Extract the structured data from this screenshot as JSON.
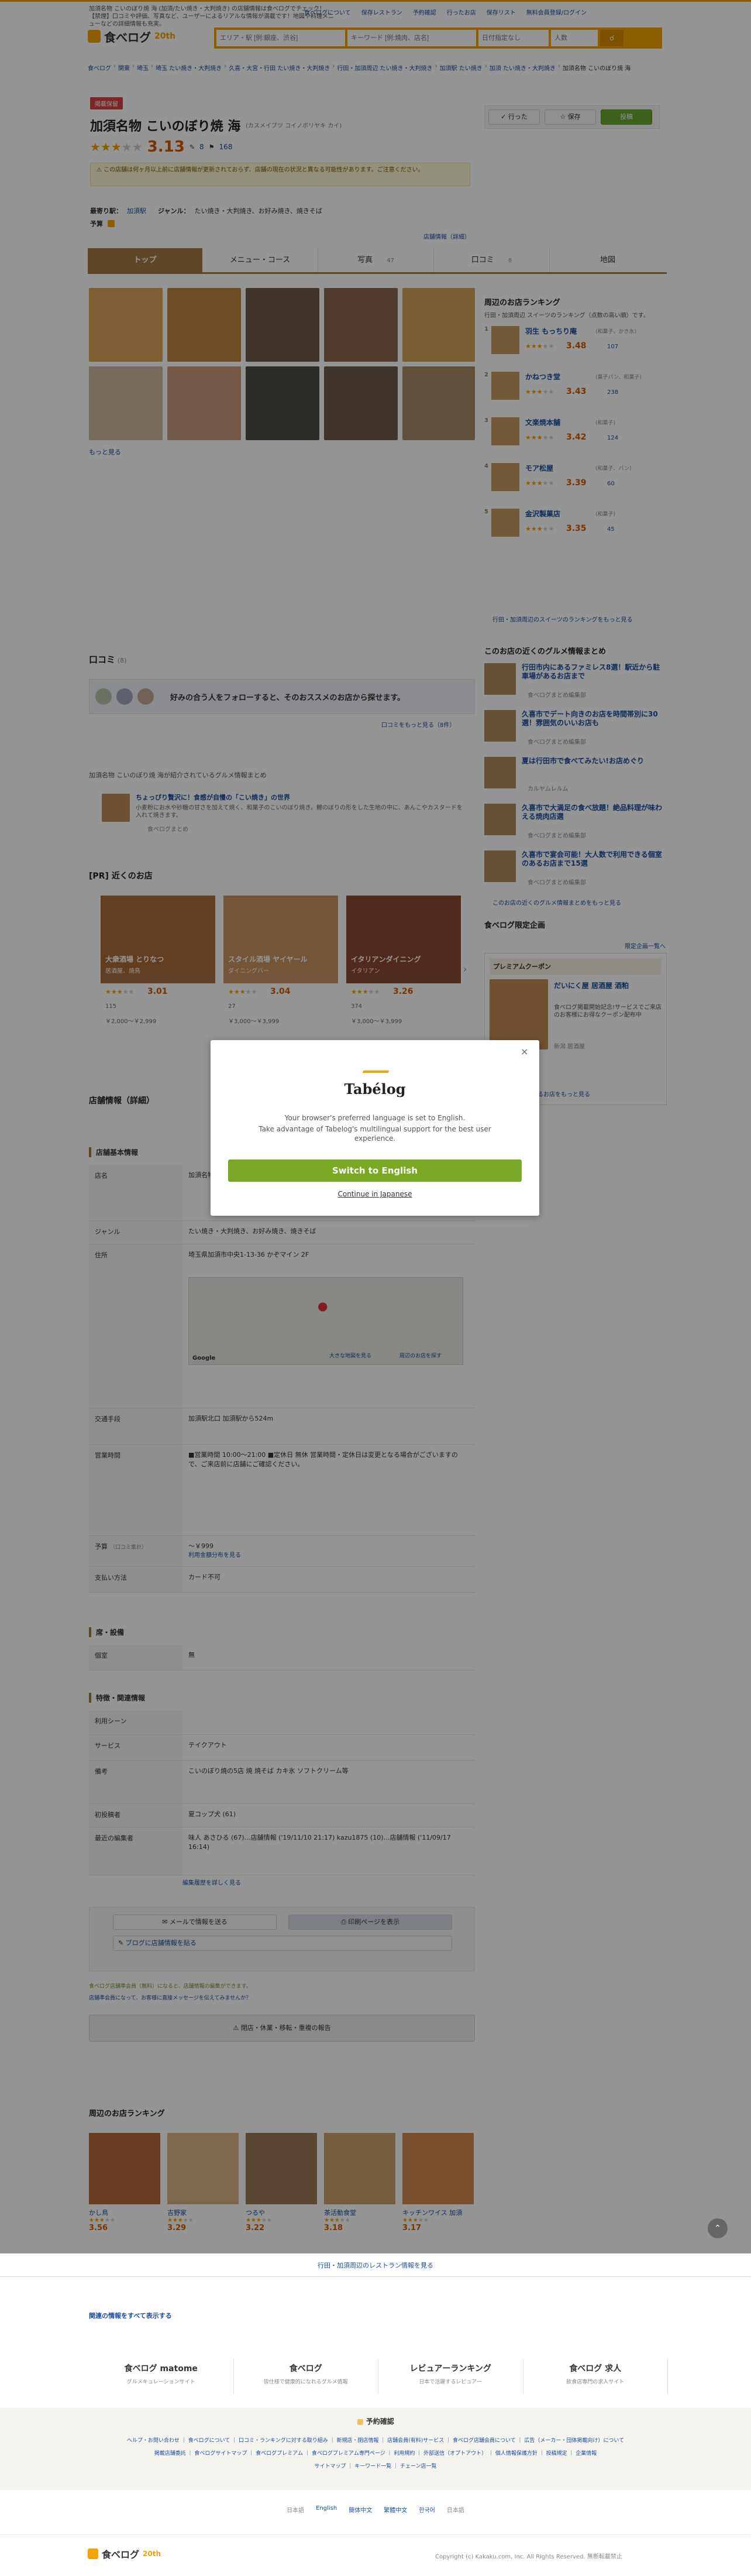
{
  "header": {
    "top_desc": "加須名物 こいのぼり焼 海 (加須/たい焼き・大判焼き) の店舗情報は食べログでチェック！ 【禁煙】口コミや評価、写真など、ユーザーによるリアルな情報が満載です！地図や料理メニューなどの詳細情報も充実。",
    "links": [
      "食べログについて",
      "保存レストラン",
      "予約確認",
      "行ったお店",
      "保存リスト",
      "無料会員登録/ログイン"
    ],
    "logo": "食べログ",
    "logo_badge": "20th",
    "search_area_placeholder": "エリア・駅 [例:銀座、渋谷]",
    "search_keyword_placeholder": "キーワード [例:焼肉、店名]",
    "date_placeholder": "日付指定なし",
    "people_placeholder": "人数"
  },
  "breadcrumb": [
    "食べログ",
    "関東",
    "埼玉",
    "埼玉 たい焼き・大判焼き",
    "久喜・大宮・行田 たい焼き・大判焼き",
    "行田・加須周辺 たい焼き・大判焼き",
    "加須駅 たい焼き",
    "加須 たい焼き・大判焼き",
    "加須名物 こいのぼり焼 海"
  ],
  "shop": {
    "badge": "掲載保留",
    "name": "加須名物 こいのぼり焼 海",
    "kana": "(カスメイブツ コイノボリヤキ カイ)",
    "rating": "3.13",
    "reviews": "8",
    "saves": "168",
    "notice": "この店舗は何ヶ月以上前に店舗情報が更新されておらず、店舗の現在の状況と異なる可能性があります。ご注意ください。",
    "station_label": "最寄り駅：",
    "station": "加須駅",
    "genre_label": "ジャンル：",
    "genre": "たい焼き・大判焼き、お好み焼き、焼きそば",
    "budget_label": "予算",
    "update_note": "店舗情報（詳細）",
    "btn_went": "行った",
    "btn_save": "保存",
    "btn_review": "投稿"
  },
  "tabs": [
    "トップ",
    "メニュー・コース",
    "写真",
    "口コミ",
    "地図"
  ],
  "tab_counts": [
    "",
    "",
    "47",
    "8",
    ""
  ],
  "more_photos": "もっと見る",
  "ranking_side": {
    "title": "周辺のお店ランキング",
    "subtitle": "行田・加須周辺 スイーツのランキング（点数の高い順）です。",
    "items": [
      {
        "rank": "1",
        "name": "羽生 もっちり庵",
        "cat": "(和菓子、かき氷)",
        "score": "3.48",
        "rev": "107"
      },
      {
        "rank": "2",
        "name": "かねつき堂",
        "cat": "(菓子パン、和菓子)",
        "score": "3.43",
        "rev": "238"
      },
      {
        "rank": "3",
        "name": "文楽焼本舗",
        "cat": "(和菓子)",
        "score": "3.42",
        "rev": "124"
      },
      {
        "rank": "4",
        "name": "モア松屋",
        "cat": "(和菓子、パン)",
        "score": "3.39",
        "rev": "60"
      },
      {
        "rank": "5",
        "name": "金沢製菓店",
        "cat": "(和菓子)",
        "score": "3.35",
        "rev": "45"
      }
    ],
    "more": "行田・加須周辺のスイーツのランキングをもっと見る"
  },
  "matome": {
    "title": "このお店の近くのグルメ情報まとめ",
    "items": [
      {
        "t": "行田市内にあるファミレス8選！駅近から駐車場があるお店まで",
        "by": "食べログまとめ編集部"
      },
      {
        "t": "久喜市でデート向きのお店を時間帯別に30選！雰囲気のいいお店も",
        "by": "食べログまとめ編集部"
      },
      {
        "t": "夏は行田市で食べてみたい!お店めぐり",
        "by": "カルヤムレルム"
      },
      {
        "t": "久喜市で大満足の食べ放題！絶品料理が味わえる焼肉店選",
        "by": "食べログまとめ編集部"
      },
      {
        "t": "久喜市で宴会可能！大人数で利用できる個室のあるお店まで15選",
        "by": "食べログまとめ編集部"
      }
    ],
    "more": "このお店の近くのグルメ情報まとめをもっと見る"
  },
  "limited": {
    "title": "食べログ限定企画",
    "more": "限定企画一覧へ",
    "premium": "プレミアムクーポン",
    "card_title": "だいにく屋 居酒屋 酒粕",
    "card_text": "食べログ掲載開始記念!サービスでご来店のお客様にお得なクーポン配布中",
    "card_label": "新潟 居酒屋",
    "card_cta": "クーポンのあるお店をもっと見る"
  },
  "review": {
    "title": "口コミ",
    "count": "(8)",
    "follow_text": "好みの合う人をフォローすると、そのおススメのお店から探せます。",
    "more_link": "口コミをもっと見る（8件）",
    "matome_title": "加須名物 こいのぼり焼 海が紹介されているグルメ情報まとめ",
    "matome_item": "ちょっぴり贅沢に！食感が自慢の「こい焼き」の世界",
    "matome_desc": "小麦粉にお水や砂糖の甘さを加えて焼く、和菓子のこいのぼり焼き。鯉のぼりの形をした生地の中に、あんこやカスタードを入れて焼きます。",
    "matome_by": "食べログまとめ"
  },
  "pr": {
    "title": "[PR] 近くのお店",
    "items": [
      {
        "name": "大衆酒場 とりなつ",
        "sub": "居酒屋、焼鳥",
        "score": "3.01",
        "rev": "115",
        "price1": "￥2,000〜￥2,999"
      },
      {
        "name": "スタイル酒場 ヤイヤール",
        "sub": "ダイニングバー",
        "score": "3.04",
        "rev": "27",
        "price1": "￥3,000〜￥3,999"
      },
      {
        "name": "イタリアンダイニング",
        "sub": "イタリアン",
        "score": "3.26",
        "rev": "374",
        "price1": "￥3,000〜￥3,999"
      }
    ]
  },
  "modal": {
    "logo": "Tabélog",
    "line1": "Your browser's preferred language is set to English.",
    "line2": "Take advantage of Tabelog's multilingual support for the best user experience.",
    "btn": "Switch to English",
    "continue": "Continue in Japanese"
  },
  "detail": {
    "title": "店舗情報（詳細）",
    "basic_title": "店舗基本情報",
    "rows": [
      {
        "k": "店名",
        "v": "加須名物 こいのぼり焼 海"
      },
      {
        "k": "ジャンル",
        "v": "たい焼き・大判焼き、お好み焼き、焼きそば"
      },
      {
        "k": "住所",
        "v": "埼玉県加須市中央1-13-36 かぞマイン 2F"
      },
      {
        "k": "交通手段",
        "v": "加須駅北口 加須駅から524m"
      },
      {
        "k": "営業時間",
        "v": "■営業時間 10:00〜21:00  ■定休日 無休  営業時間・定休日は変更となる場合がございますので、ご来店前に店舗にご確認ください。"
      },
      {
        "k": "予算",
        "v": "〜￥999"
      },
      {
        "k": "支払い方法",
        "v": "カード不可"
      }
    ],
    "seat_title": "席・設備",
    "seat_rows": [
      {
        "k": "個室",
        "v": "無"
      }
    ],
    "feature_title": "特徴・関連情報",
    "feature_rows": [
      {
        "k": "利用シーン",
        "v": ""
      },
      {
        "k": "サービス",
        "v": "テイクアウト"
      },
      {
        "k": "備考",
        "v": "こいのぼり焼の5店 焼 焼そば カキ氷 ソフトクリーム等"
      },
      {
        "k": "初投稿者",
        "v": "夏コップ犬 (61)"
      },
      {
        "k": "最近の編集者",
        "v": "味人 あさひる (67)…店舗情報 ('19/11/10 21:17)  kazu1875 (10)…店舗情報 ('11/09/17 16:14)"
      }
    ],
    "map_note": "Google",
    "map_link1": "大きな地図を見る",
    "map_link2": "周辺のお店を探す",
    "edit_link": "編集履歴を詳しく見る",
    "budget_label": "（口コミ集計）",
    "budget_link": "利用金額分布を見る",
    "share_btn": "メールで情報を送る",
    "print_btn": "印刷ページを表示",
    "blog_btn": "ブログに店舗情報を貼る",
    "note1": "食べログ店舗準会員（無料）になると、店舗情報の編集ができます。",
    "note2": "店舗準会員になって、お客様に直接メッセージを伝えてみませんか？",
    "report_btn": "閉店・休業・移転・重複の報告"
  },
  "bottom_ranking": {
    "title": "周辺のお店ランキング",
    "items": [
      {
        "name": "かし鳥",
        "score": "3.56"
      },
      {
        "name": "吉野家",
        "score": "3.29"
      },
      {
        "name": "つるや",
        "score": "3.22"
      },
      {
        "name": "茶活動食堂",
        "score": "3.18"
      },
      {
        "name": "キッチンワイス 加須",
        "score": "3.17"
      }
    ],
    "more": "行田・加須周辺のレストラン情報を見る"
  },
  "footer": {
    "all_link": "関連の情報をすべて表示する",
    "services": [
      {
        "name": "食べログ matome",
        "sub": "グルメキュレーションサイト"
      },
      {
        "name": "食べログ",
        "sub": "皆仕様で健康的になれるグルメ情報"
      },
      {
        "name": "レビュアーランキング",
        "sub": "日本で活躍するレビュアー"
      },
      {
        "name": "食べログ 求人",
        "sub": "飲食店専門の求人サイト"
      }
    ],
    "confirm": "予約確認",
    "links1": "ヘルプ・お問い合わせ ｜ 食べログについて ｜ 口コミ・ランキングに対する取り組み ｜ 新規店・閉店情報 ｜ 店舗会員(有料)サービス ｜ 食べログ店舗会員について ｜ 広告（メーカー・団体掲載向け）について",
    "links2": "掲載店舗委託 ｜ 食べログサイトマップ ｜ 食べログプレミアム ｜ 食べログプレミアム専門ページ ｜ 利用規約 ｜ 外部送信（オプトアウト） ｜ 個人情報保護方針 ｜ 投稿規定 ｜ 企業情報",
    "links3": "サイトマップ ｜ キーワード一覧 ｜ チェーン店一覧",
    "langs": [
      "日本語",
      "English",
      "簡体中文",
      "繁體中文",
      "한국어",
      "日本語"
    ],
    "copyright": "Copyright (c) Kakaku.com, Inc. All Rights Reserved. 無断転載禁止",
    "logo": "食べログ",
    "badge": "20th"
  }
}
